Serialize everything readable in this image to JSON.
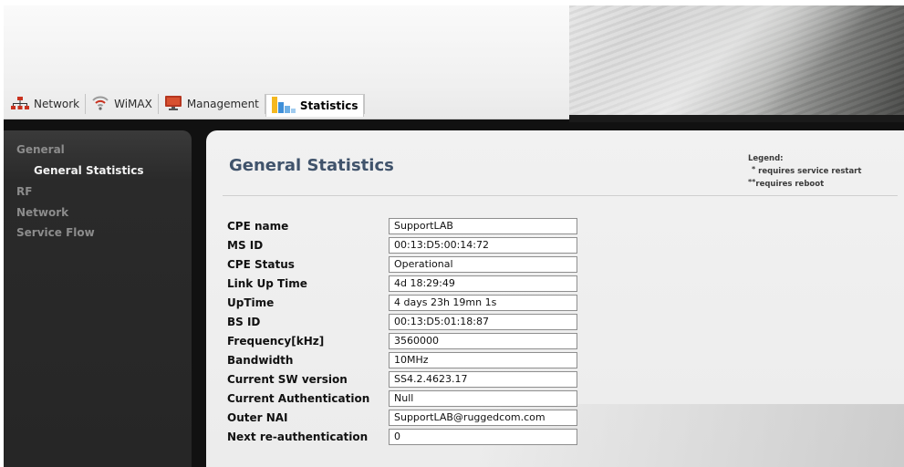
{
  "tabs": [
    {
      "label": "Network",
      "icon": "network-icon",
      "active": false
    },
    {
      "label": "WiMAX",
      "icon": "wifi-icon",
      "active": false
    },
    {
      "label": "Management",
      "icon": "monitor-icon",
      "active": false
    },
    {
      "label": "Statistics",
      "icon": "bar-chart-icon",
      "active": true
    }
  ],
  "sidebar": {
    "items": [
      {
        "label": "General"
      },
      {
        "label": "General Statistics"
      },
      {
        "label": "RF"
      },
      {
        "label": "Network"
      },
      {
        "label": "Service Flow"
      }
    ]
  },
  "main": {
    "title": "General Statistics",
    "legend": {
      "title": "Legend:",
      "restart_mark": "*",
      "restart_text": "requires service restart",
      "reboot_mark": "**",
      "reboot_text": "requires reboot"
    },
    "fields": [
      {
        "label": "CPE name",
        "value": "SupportLAB"
      },
      {
        "label": "MS ID",
        "value": "00:13:D5:00:14:72"
      },
      {
        "label": "CPE Status",
        "value": "Operational"
      },
      {
        "label": "Link Up Time",
        "value": "4d 18:29:49"
      },
      {
        "label": "UpTime",
        "value": "4 days 23h 19mn 1s"
      },
      {
        "label": "BS ID",
        "value": "00:13:D5:01:18:87"
      },
      {
        "label": "Frequency[kHz]",
        "value": "3560000"
      },
      {
        "label": "Bandwidth",
        "value": "10MHz"
      },
      {
        "label": "Current SW version",
        "value": "SS4.2.4623.17"
      },
      {
        "label": "Current Authentication",
        "value": "Null"
      },
      {
        "label": "Outer NAI",
        "value": "SupportLAB@ruggedcom.com"
      },
      {
        "label": "Next re-authentication",
        "value": "0"
      }
    ]
  },
  "colors": {
    "title": "#40536b",
    "sidebar_bg": "#262626",
    "sidebar_inactive": "#8c8c8c",
    "sidebar_active": "#f2f2f2"
  }
}
